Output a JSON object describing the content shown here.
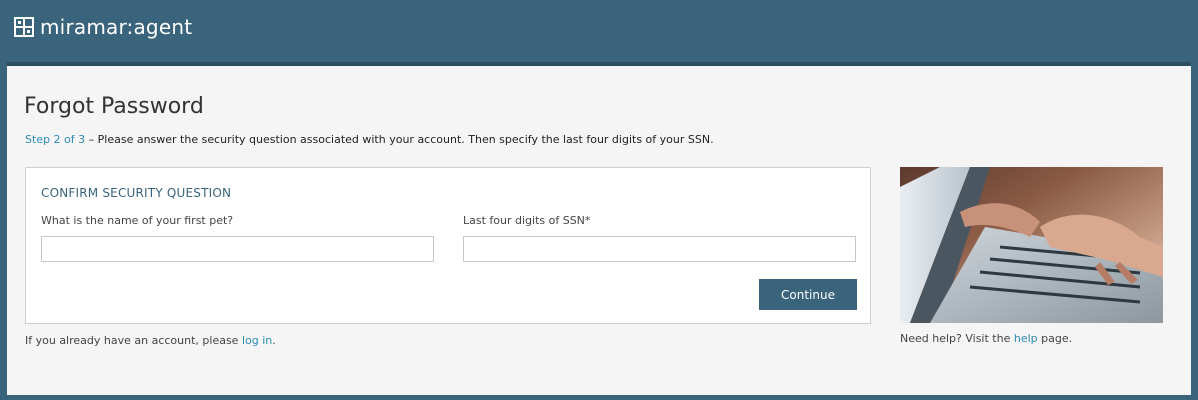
{
  "header": {
    "brand_name": "miramar:agent",
    "logo_icon": "grid-logo-icon"
  },
  "page": {
    "title": "Forgot Password",
    "step_label": "Step 2 of 3",
    "step_text": " – Please answer the security question associated with your account. Then specify the last four digits of your SSN."
  },
  "form": {
    "heading": "CONFIRM SECURITY QUESTION",
    "question_label": "What is the name of your first pet?",
    "question_value": "",
    "ssn_label": "Last four digits of SSN*",
    "ssn_value": "",
    "continue_label": "Continue"
  },
  "footer": {
    "login_prefix": "If you already have an account, please ",
    "login_link": "log in",
    "login_suffix": "."
  },
  "sidebar": {
    "image_icon": "laptop-typing-photo",
    "help_prefix": "Need help? Visit the ",
    "help_link": "help",
    "help_suffix": " page."
  },
  "colors": {
    "header_bg": "#3a647c",
    "accent_link": "#2f8bb4",
    "button_bg": "#3a647c"
  }
}
